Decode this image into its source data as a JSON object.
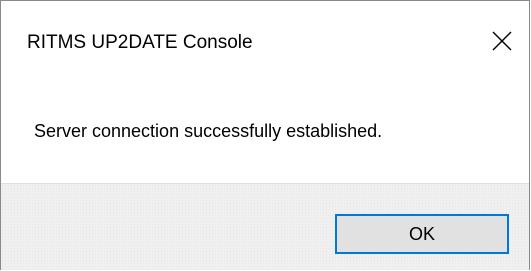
{
  "window": {
    "title": "RITMS UP2DATE Console",
    "close_icon": "close-icon"
  },
  "dialog": {
    "message": "Server connection successfully established."
  },
  "buttons": {
    "ok_label": "OK"
  },
  "colors": {
    "accent": "#0078d7",
    "footer_background": "#f0f0f0",
    "button_background": "#e1e1e1"
  }
}
